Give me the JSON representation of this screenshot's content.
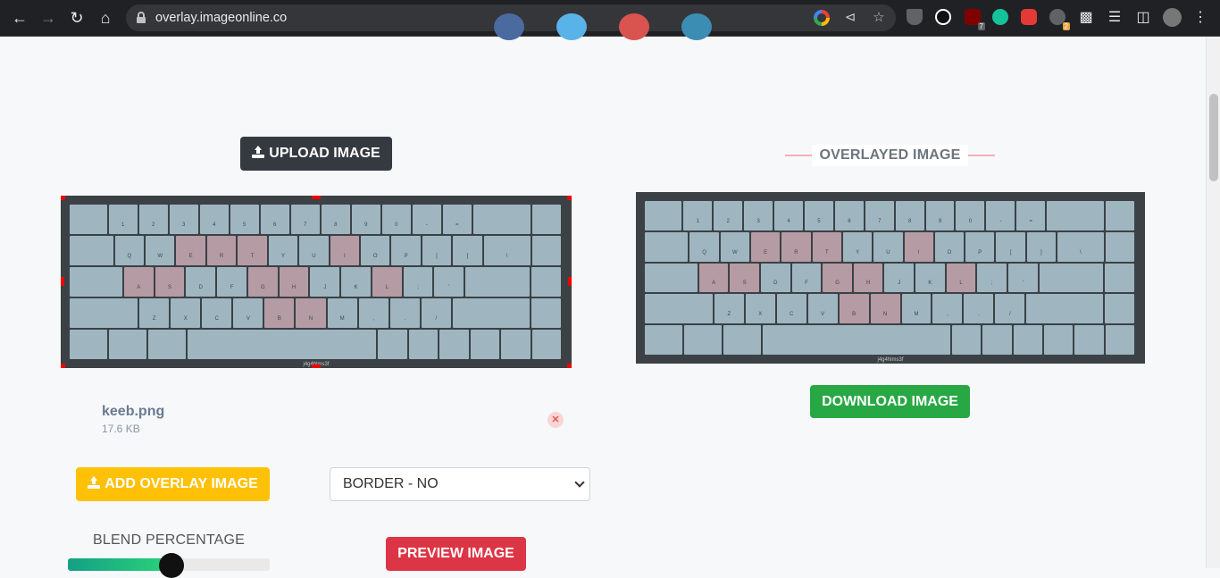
{
  "browser": {
    "url": "overlay.imageonline.co",
    "extension_badges": {
      "ublock": "7",
      "reader": "2"
    }
  },
  "upload_button": "UPLOAD IMAGE",
  "overlayed_title": "OVERLAYED IMAGE",
  "download_button": "DOWNLOAD IMAGE",
  "file": {
    "name": "keeb.png",
    "size": "17.6 KB"
  },
  "add_overlay_button": "ADD OVERLAY IMAGE",
  "border_select": {
    "value": "BORDER - NO",
    "options": [
      "BORDER - NO"
    ]
  },
  "blend": {
    "label": "BLEND PERCENTAGE",
    "value_percent": 50
  },
  "preview_button": "PREVIEW IMAGE",
  "keyboard": {
    "watermark": "j4g4hlms3f",
    "rows": [
      [
        "",
        "1",
        "2",
        "3",
        "4",
        "5",
        "6",
        "7",
        "8",
        "9",
        "0",
        "-",
        "=",
        "",
        ""
      ],
      [
        "",
        "Q",
        "W",
        "E",
        "R",
        "T",
        "Y",
        "U",
        "I",
        "O",
        "P",
        "[",
        "]",
        "\\",
        ""
      ],
      [
        "",
        "A",
        "S",
        "D",
        "F",
        "G",
        "H",
        "J",
        "K",
        "L",
        ";",
        "'",
        "",
        ""
      ],
      [
        "",
        "Z",
        "X",
        "C",
        "V",
        "B",
        "N",
        "M",
        ",",
        ".",
        "/",
        "",
        ""
      ],
      [
        "",
        "",
        "",
        "",
        "",
        "",
        "",
        "",
        "",
        ""
      ]
    ],
    "highlighted": [
      "E",
      "R",
      "T",
      "I",
      "A",
      "S",
      "G",
      "H",
      "L",
      "B",
      "N"
    ]
  },
  "colors": {
    "accent_green": "#28a745",
    "accent_yellow": "#ffc107",
    "accent_red": "#dc3545",
    "dark": "#343a40"
  }
}
